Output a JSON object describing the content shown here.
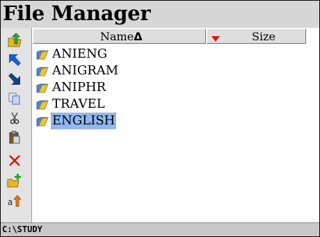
{
  "app": {
    "title": "File Manager"
  },
  "toolbar": {
    "buttons": [
      {
        "name": "parent-folder-button",
        "icon": "folder-up-icon"
      },
      {
        "name": "go-top-button",
        "icon": "arrow-up-left-icon"
      },
      {
        "name": "go-bottom-button",
        "icon": "arrow-down-right-icon"
      },
      {
        "name": "copy-button",
        "icon": "copy-icon"
      },
      {
        "name": "cut-button",
        "icon": "scissors-icon"
      },
      {
        "name": "paste-button",
        "icon": "paste-icon"
      },
      {
        "name": "delete-button",
        "icon": "red-x-icon"
      },
      {
        "name": "new-folder-button",
        "icon": "new-folder-icon"
      },
      {
        "name": "rename-button",
        "icon": "rename-icon"
      }
    ]
  },
  "columns": {
    "name": "Name",
    "sort_indicator": "Δ",
    "size": "Size"
  },
  "files": [
    {
      "name": "ANIENG",
      "selected": false
    },
    {
      "name": "ANIGRAM",
      "selected": false
    },
    {
      "name": "ANIPHR",
      "selected": false
    },
    {
      "name": "TRAVEL",
      "selected": false
    },
    {
      "name": "ENGLISH",
      "selected": true
    }
  ],
  "status": {
    "path": "C:\\STUDY"
  },
  "colors": {
    "selection": "#8fb7f2",
    "toolbar_bg": "#e3e3e3",
    "title_bg": "#d7d7d7",
    "status_bg": "#c8c8c8",
    "accent_red": "#e01010"
  }
}
